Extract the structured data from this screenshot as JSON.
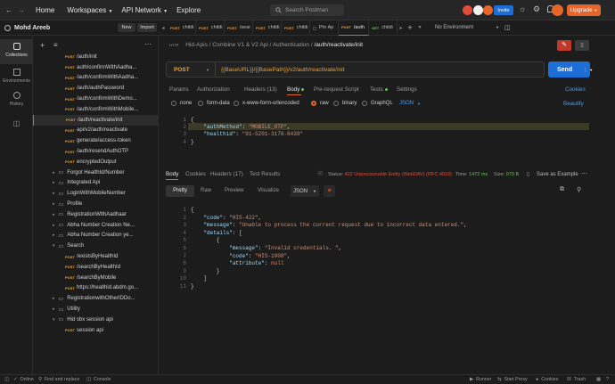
{
  "topbar": {
    "home": "Home",
    "workspaces": "Workspaces",
    "api_network": "API Network",
    "explore": "Explore",
    "search_placeholder": "Search Postman",
    "invite": "Invite",
    "upgrade": "Upgrade"
  },
  "workspace": {
    "name": "Mohd Areeb",
    "new": "New",
    "import": "Import"
  },
  "rail": {
    "collections": "Collections",
    "environments": "Environments",
    "history": "History"
  },
  "sidebar": {
    "items": [
      {
        "type": "req",
        "method": "POST",
        "label": "/auth/init"
      },
      {
        "type": "req",
        "method": "POST",
        "label": "auth/confirmWithAadha..."
      },
      {
        "type": "req",
        "method": "POST",
        "label": "/auth/confirmWithAadha..."
      },
      {
        "type": "req",
        "method": "POST",
        "label": "/auth/authPassword"
      },
      {
        "type": "req",
        "method": "POST",
        "label": "/auth/confirmWithDemo..."
      },
      {
        "type": "req",
        "method": "POST",
        "label": "/auth/confirmWithMobile..."
      },
      {
        "type": "req",
        "method": "POST",
        "label": "/auth/reactivate/init",
        "selected": true
      },
      {
        "type": "req",
        "method": "POST",
        "label": "api/v2/auth/reactivate"
      },
      {
        "type": "req",
        "method": "POST",
        "label": "generate/access-token"
      },
      {
        "type": "req",
        "method": "POST",
        "label": "/auth/resendAuthOTP"
      },
      {
        "type": "req",
        "method": "POST",
        "label": "encryptedOutput"
      },
      {
        "type": "folder",
        "label": "Forgot HealthId/Number"
      },
      {
        "type": "folder",
        "label": "Integrated Api"
      },
      {
        "type": "folder",
        "label": "LoginWithMobileNumber"
      },
      {
        "type": "folder",
        "label": "Profile"
      },
      {
        "type": "folder",
        "label": "RegistrationWithAadhaar"
      },
      {
        "type": "folder",
        "label": "Abha Number Creation Ne..."
      },
      {
        "type": "folder",
        "label": "Abha Number Creation ye..."
      },
      {
        "type": "folder-open",
        "label": "Search"
      },
      {
        "type": "req",
        "method": "POST",
        "label": "/existsByHealthId"
      },
      {
        "type": "req",
        "method": "POST",
        "label": "/searchByHealthId"
      },
      {
        "type": "req",
        "method": "POST",
        "label": "/searchByMobile"
      },
      {
        "type": "req",
        "method": "POST",
        "label": "https://healthid.abdm.go..."
      },
      {
        "type": "folder",
        "label": "RegistrationwithOtherIDDo..."
      },
      {
        "type": "folder",
        "label": "Utility"
      },
      {
        "type": "folder-open",
        "label": "Hid sbx session api"
      },
      {
        "type": "req",
        "method": "POST",
        "label": "session api"
      }
    ]
  },
  "tabs": [
    {
      "method": "POST",
      "label": "childi"
    },
    {
      "method": "POST",
      "label": "childi"
    },
    {
      "method": "POST",
      "label": "/sear"
    },
    {
      "method": "POST",
      "label": "childi"
    },
    {
      "method": "POST",
      "label": "childi"
    },
    {
      "method": "",
      "label": "Phr Ap"
    },
    {
      "method": "POST",
      "label": "/auth",
      "active": true
    },
    {
      "method": "GET",
      "label": "childi"
    }
  ],
  "environment": "No Environment",
  "breadcrumb": {
    "root": "Hid-Apis",
    "c1": "Combine V1 & V2 Api",
    "c2": "Authentication",
    "current": "/auth/reactivate/init"
  },
  "request": {
    "method": "POST",
    "url": "{{BaseURL}}/{{BasePath}}/v2/auth/reactivate/init",
    "send": "Send"
  },
  "req_tabs": {
    "params": "Params",
    "authorization": "Authorization",
    "headers": "Headers (13)",
    "body": "Body",
    "prescript": "Pre-request Script",
    "tests": "Tests",
    "settings": "Settings",
    "cookies": "Cookies"
  },
  "body_modes": {
    "none": "none",
    "form_data": "form-data",
    "urlencoded": "x-www-form-urlencoded",
    "raw": "raw",
    "binary": "binary",
    "graphql": "GraphQL",
    "lang": "JSON",
    "beautify": "Beautify"
  },
  "request_body": [
    "{",
    "    \"authMethod\": \"MOBILE_OTP\",",
    "    \"healthid\": \"91-5201-3178-8439\"",
    "}"
  ],
  "response": {
    "tabs": {
      "body": "Body",
      "cookies": "Cookies",
      "headers": "Headers (17)",
      "tests": "Test Results"
    },
    "status_label": "Status:",
    "status": "422 Unprocessable Entity (WebDAV) (RFC 4918)",
    "time_label": "Time:",
    "time": "1472 ms",
    "size_label": "Size:",
    "size": "979 B",
    "save": "Save as Example",
    "views": {
      "pretty": "Pretty",
      "raw": "Raw",
      "preview": "Preview",
      "visualize": "Visualize",
      "format": "JSON"
    }
  },
  "response_body": [
    "{",
    "    \"code\": \"HIS-422\",",
    "    \"message\": \"Unable to process the current request due to incorrect data entered.\",",
    "    \"details\": [",
    "        {",
    "            \"message\": \"Invalid credentials. \",",
    "            \"code\": \"HIS-1008\",",
    "            \"attribute\": null",
    "        }",
    "    ]",
    "}"
  ],
  "statusbar": {
    "online": "Online",
    "find": "Find and replace",
    "console": "Console",
    "runner": "Runner",
    "proxy": "Start Proxy",
    "cookies": "Cookies",
    "trash": "Trash"
  },
  "colors": {
    "accent": "#e8652a",
    "send": "#1b6fd6",
    "method_post": "#e8a23a",
    "method_get": "#6bbd5b"
  }
}
